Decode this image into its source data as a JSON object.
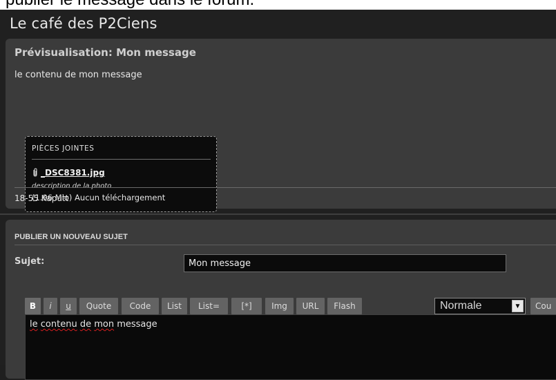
{
  "caption": "publier le message dans le forum.",
  "site": {
    "title": "Le café des P2Ciens"
  },
  "preview": {
    "title": "Prévisualisation: Mon message",
    "body": "le contenu de mon message",
    "attachments": {
      "header": "PIÈCES JOINTES",
      "clip_icon": "paperclip-icon",
      "file_name": "_DSC8381.jpg",
      "description": "description de la photo",
      "meta": "(1.96 Mio) Aucun téléchargement"
    },
    "signature": "18-55 Kaputt"
  },
  "post": {
    "heading": "PUBLIER UN NOUVEAU SUJET",
    "subject_label": "Sujet:",
    "subject_value": "Mon message",
    "toolbar": {
      "bold": "B",
      "italic": "i",
      "underline": "u",
      "quote": "Quote",
      "code": "Code",
      "list": "List",
      "list_eq": "List=",
      "list_item": "[*]",
      "img": "Img",
      "url": "URL",
      "flash": "Flash",
      "font_size": "Normale",
      "color": "Cou"
    },
    "editor_words": [
      "le",
      "contenu",
      "de",
      "mon",
      "message"
    ]
  },
  "colors": {
    "background": "#202020",
    "panel": "#3b3b3b",
    "button": "#636363",
    "spellcheck_underline": "#d62020"
  }
}
